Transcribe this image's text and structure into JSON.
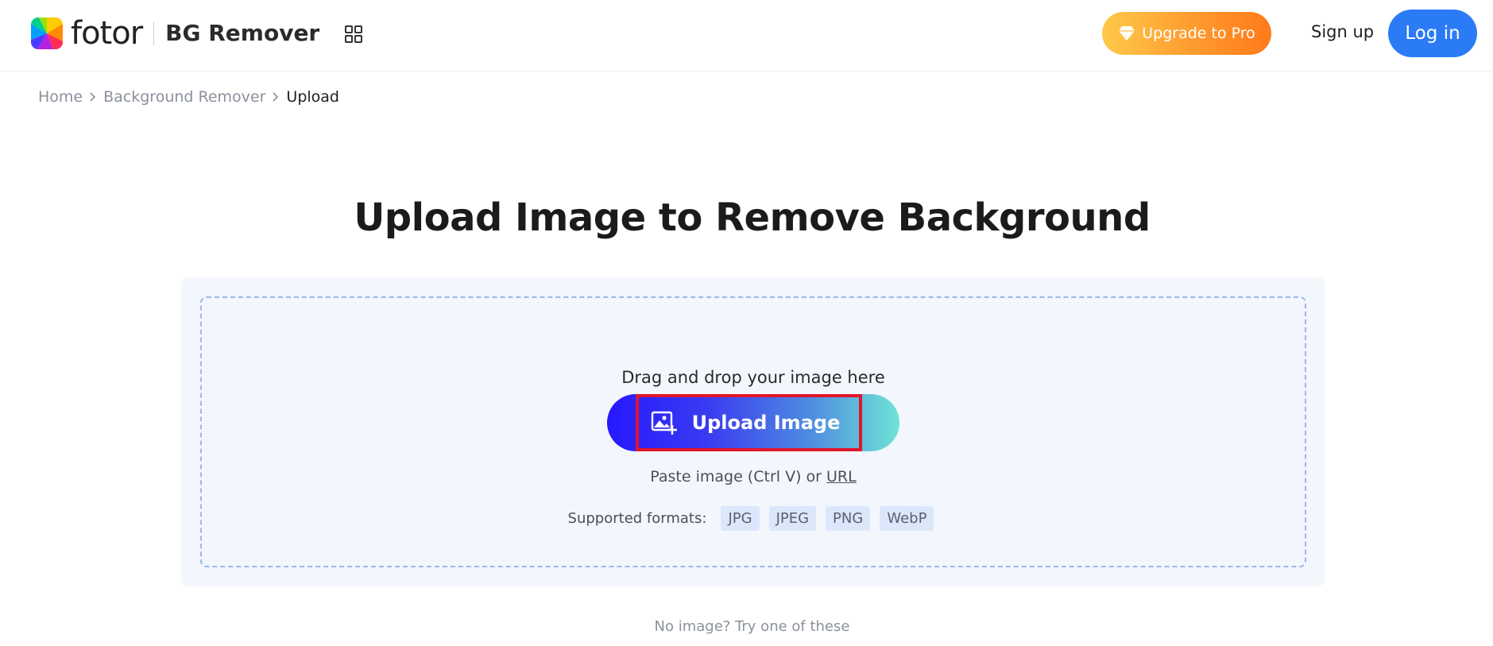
{
  "header": {
    "logo_text": "fotor",
    "product_name": "BG Remover",
    "apps_icon": "grid-icon",
    "upgrade_label": "Upgrade to Pro",
    "signup_label": "Sign up",
    "login_label": "Log in"
  },
  "breadcrumb": {
    "items": [
      "Home",
      "Background Remover"
    ],
    "current": "Upload"
  },
  "main": {
    "title": "Upload Image to Remove Background",
    "drag_text": "Drag and drop your image here",
    "upload_label": "Upload Image",
    "paste_text": "Paste image (Ctrl V) or",
    "url_label": "URL",
    "formats_label": "Supported formats:",
    "formats": [
      "JPG",
      "JPEG",
      "PNG",
      "WebP"
    ],
    "no_image_text": "No image? Try one of these"
  },
  "colors": {
    "accent_blue": "#2b7bf7",
    "upgrade_orange": "#ff8a24",
    "highlight_red": "#e0162b"
  }
}
